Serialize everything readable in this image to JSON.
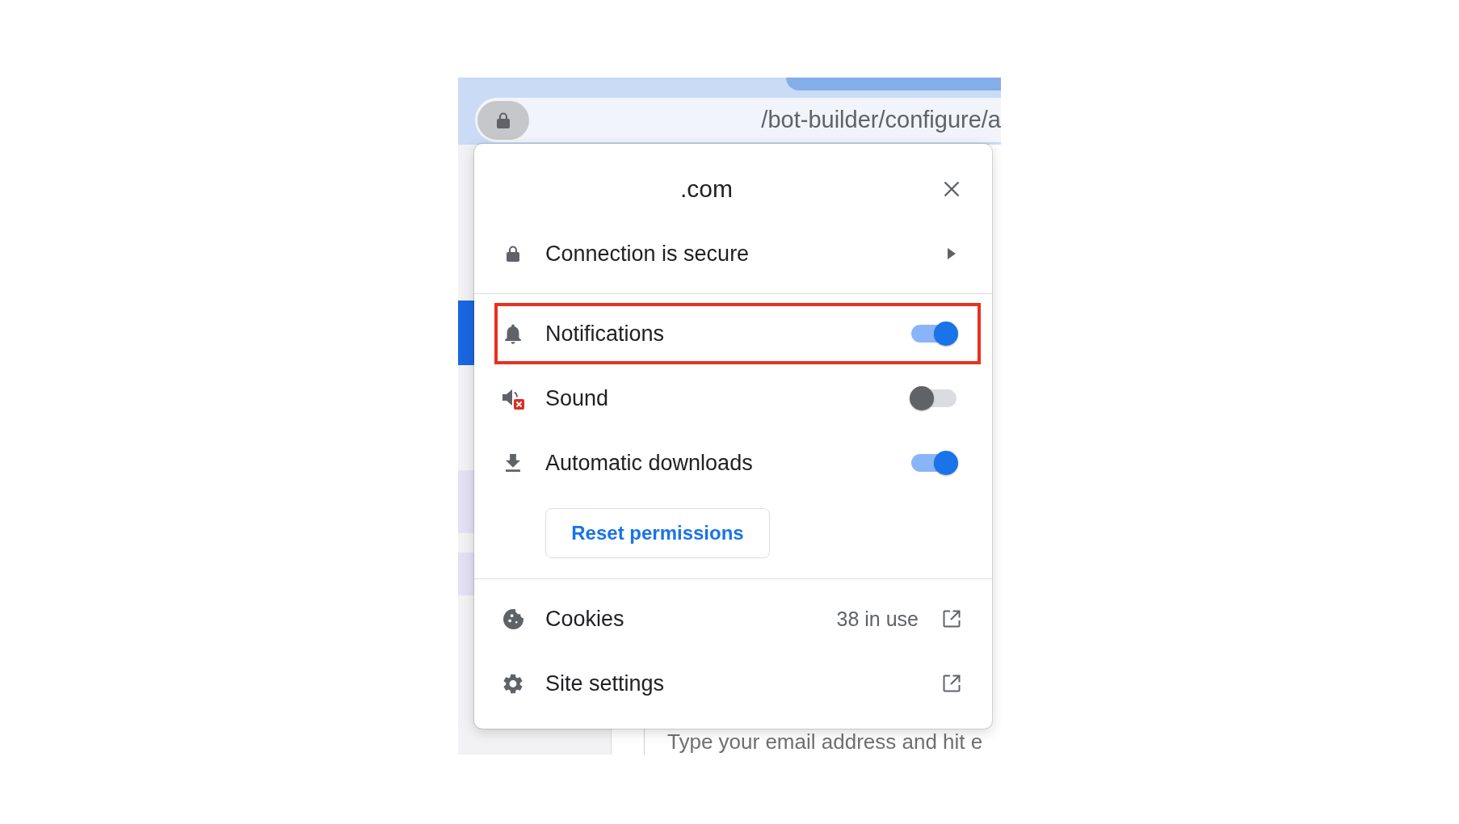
{
  "browser": {
    "address_bar": {
      "value": "/bot-builder/configure/a"
    }
  },
  "popup": {
    "title": ".com",
    "connection": {
      "label": "Connection is secure"
    },
    "permissions": [
      {
        "label": "Notifications",
        "on": true,
        "highlighted": true
      },
      {
        "label": "Sound",
        "on": false,
        "highlighted": false
      },
      {
        "label": "Automatic downloads",
        "on": true,
        "highlighted": false
      }
    ],
    "reset_button": {
      "label": "Reset permissions"
    },
    "links": [
      {
        "label": "Cookies",
        "detail": "38 in use"
      },
      {
        "label": "Site settings"
      }
    ]
  },
  "page": {
    "email_field": {
      "placeholder": "Type your email address and hit e"
    }
  }
}
